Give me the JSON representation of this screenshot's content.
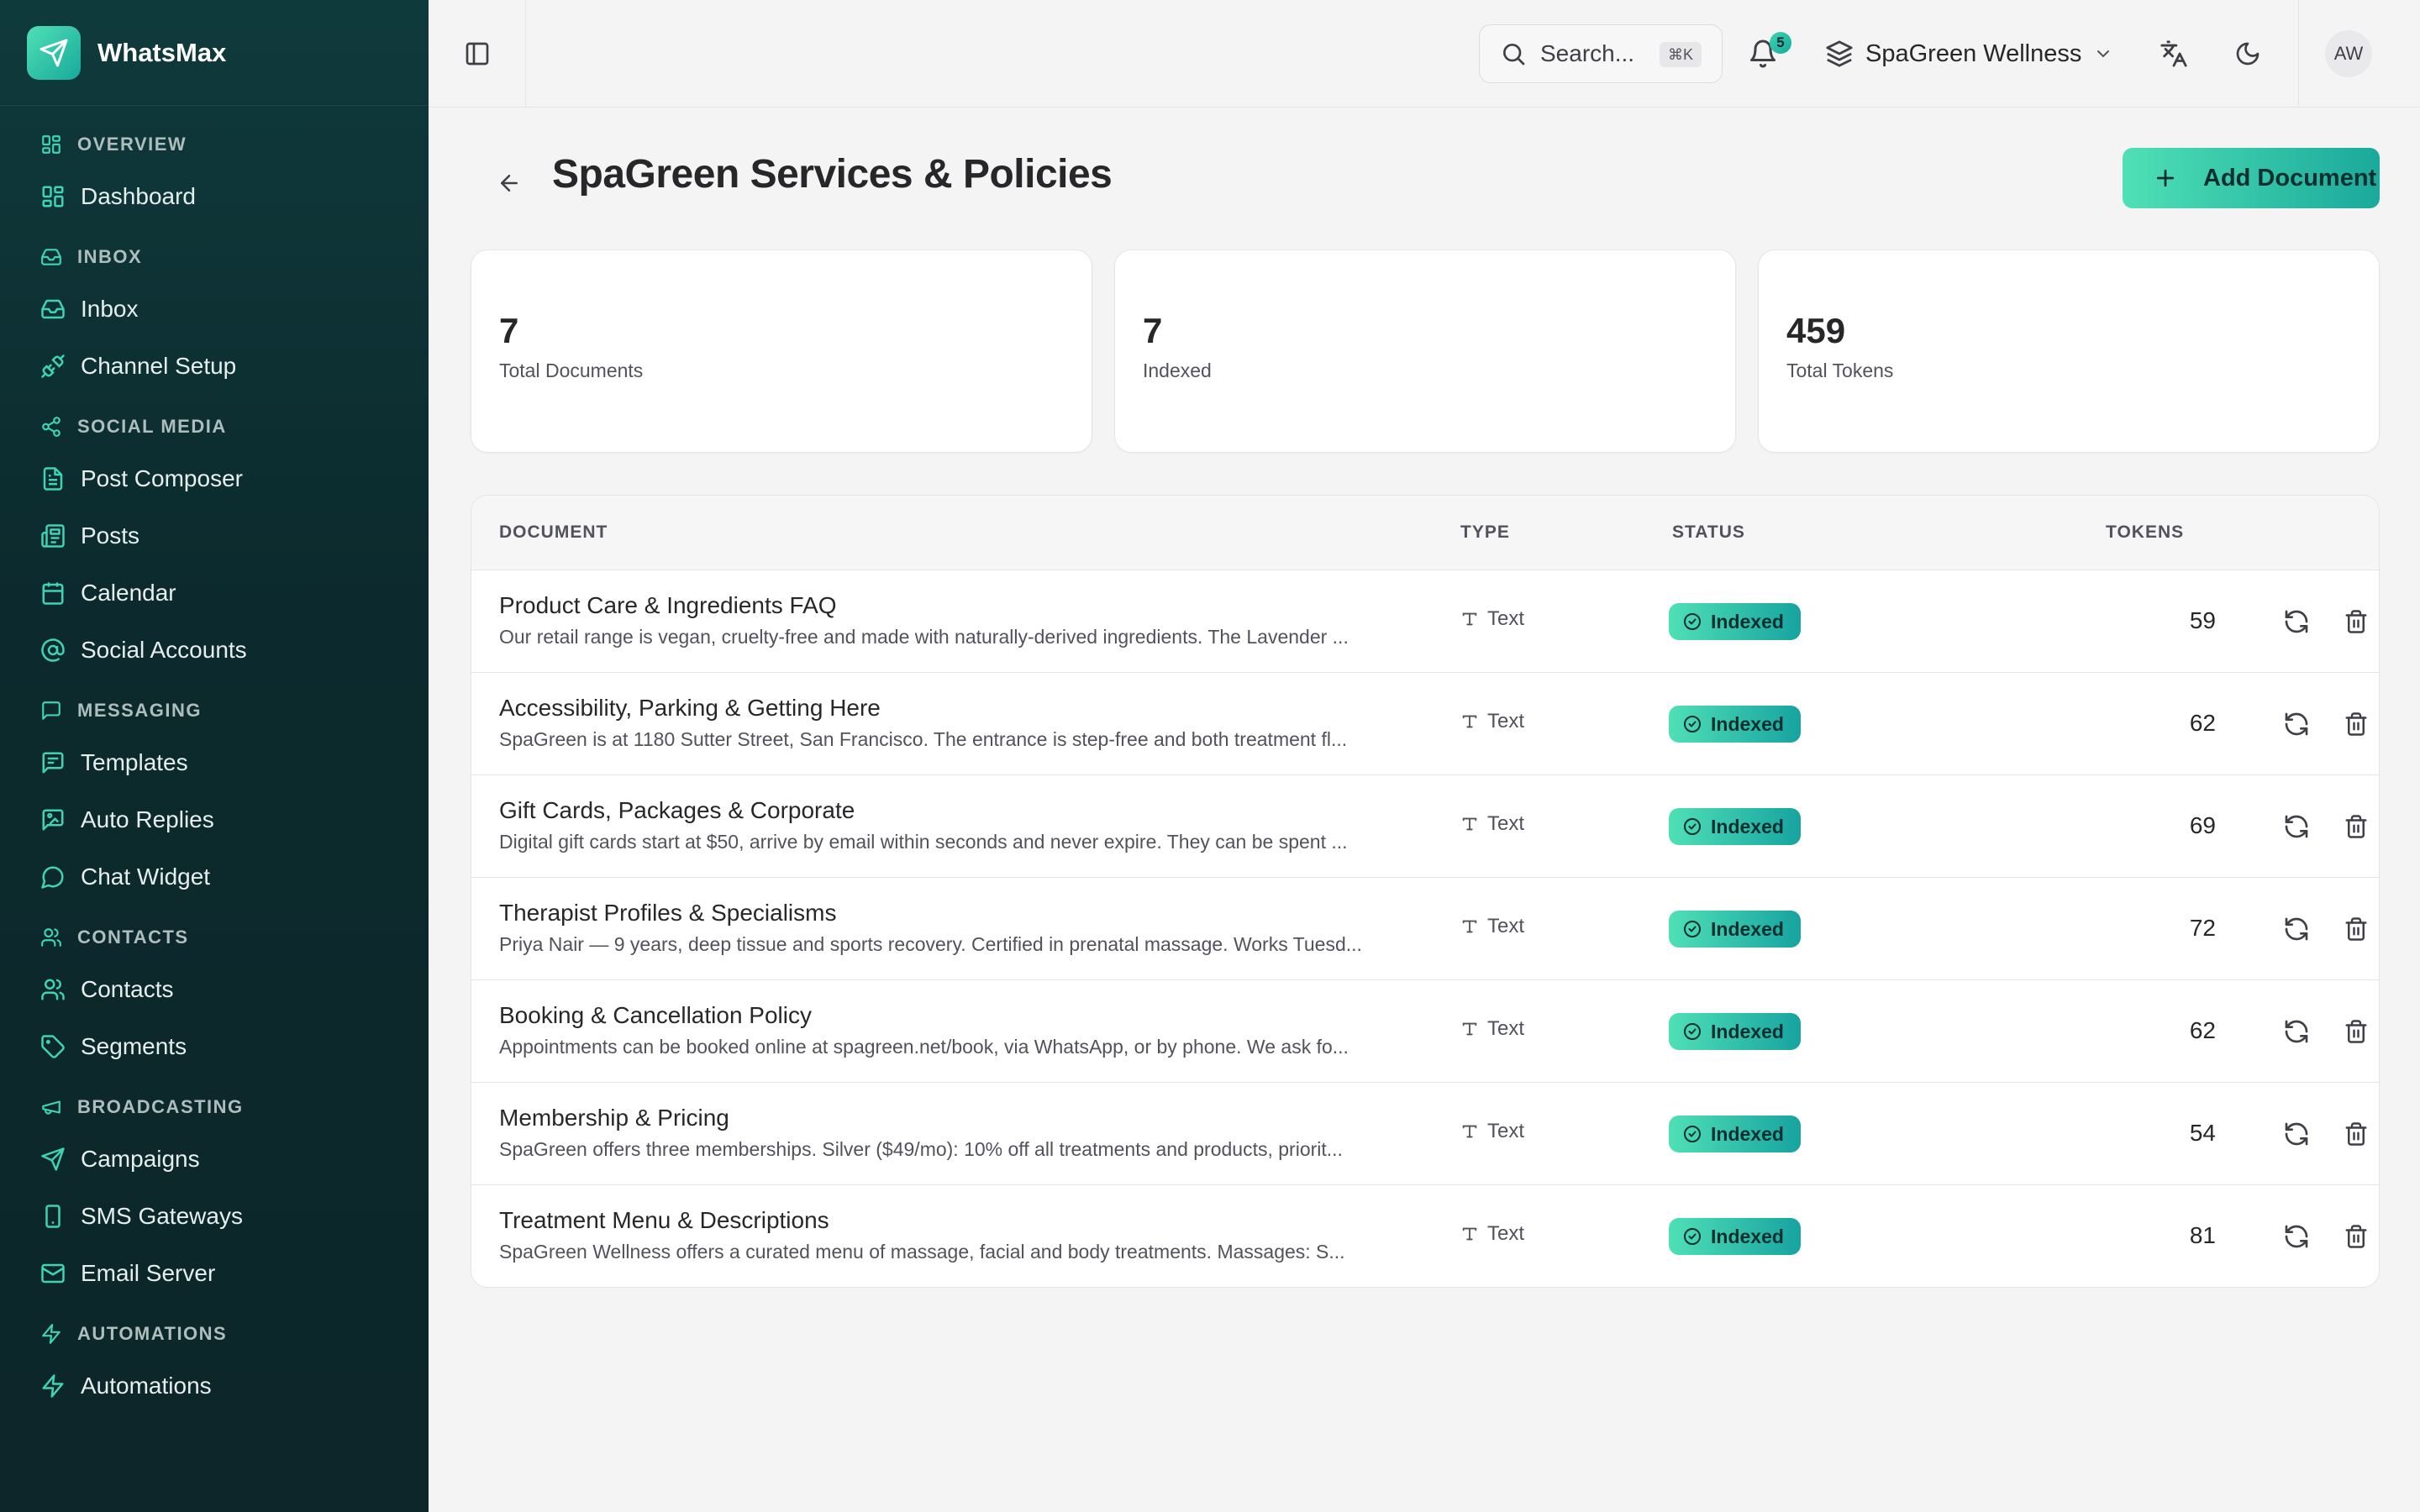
{
  "app": {
    "name": "WhatsMax",
    "accent": "#3fd3b4",
    "sidebar_bg": "#0c2a2d"
  },
  "sidebar": {
    "sections": [
      {
        "label": "OVERVIEW",
        "icon": "grid-icon",
        "items": [
          {
            "label": "Dashboard",
            "icon": "dashboard-icon"
          }
        ]
      },
      {
        "label": "INBOX",
        "icon": "inbox-icon",
        "items": [
          {
            "label": "Inbox",
            "icon": "inbox-icon"
          },
          {
            "label": "Channel Setup",
            "icon": "plug-icon"
          }
        ]
      },
      {
        "label": "SOCIAL MEDIA",
        "icon": "share-icon",
        "items": [
          {
            "label": "Post Composer",
            "icon": "file-text-icon"
          },
          {
            "label": "Posts",
            "icon": "newspaper-icon"
          },
          {
            "label": "Calendar",
            "icon": "calendar-icon"
          },
          {
            "label": "Social Accounts",
            "icon": "at-sign-icon"
          }
        ]
      },
      {
        "label": "MESSAGING",
        "icon": "message-square-icon",
        "items": [
          {
            "label": "Templates",
            "icon": "template-icon"
          },
          {
            "label": "Auto Replies",
            "icon": "message-image-icon"
          },
          {
            "label": "Chat Widget",
            "icon": "message-circle-icon"
          }
        ]
      },
      {
        "label": "CONTACTS",
        "icon": "users-icon",
        "items": [
          {
            "label": "Contacts",
            "icon": "users-icon"
          },
          {
            "label": "Segments",
            "icon": "tag-icon"
          }
        ]
      },
      {
        "label": "BROADCASTING",
        "icon": "megaphone-icon",
        "items": [
          {
            "label": "Campaigns",
            "icon": "send-icon"
          },
          {
            "label": "SMS Gateways",
            "icon": "smartphone-icon"
          },
          {
            "label": "Email Server",
            "icon": "mail-icon"
          }
        ]
      },
      {
        "label": "AUTOMATIONS",
        "icon": "zap-icon",
        "items": [
          {
            "label": "Automations",
            "icon": "zap-icon"
          }
        ]
      }
    ]
  },
  "topbar": {
    "search_placeholder": "Search...",
    "search_shortcut": "⌘K",
    "notification_count": "5",
    "workspace": "SpaGreen Wellness",
    "avatar_initials": "AW"
  },
  "page": {
    "title": "SpaGreen Services & Policies",
    "add_button": "Add Document"
  },
  "stats": [
    {
      "value": "7",
      "label": "Total Documents"
    },
    {
      "value": "7",
      "label": "Indexed"
    },
    {
      "value": "459",
      "label": "Total Tokens"
    }
  ],
  "table": {
    "headers": {
      "document": "DOCUMENT",
      "type": "TYPE",
      "status": "STATUS",
      "tokens": "TOKENS"
    },
    "rows": [
      {
        "title": "Product Care & Ingredients FAQ",
        "description": "Our retail range is vegan, cruelty-free and made with naturally-derived ingredients. The Lavender ...",
        "type": "Text",
        "status": "Indexed",
        "tokens": "59"
      },
      {
        "title": "Accessibility, Parking & Getting Here",
        "description": "SpaGreen is at 1180 Sutter Street, San Francisco. The entrance is step-free and both treatment fl...",
        "type": "Text",
        "status": "Indexed",
        "tokens": "62"
      },
      {
        "title": "Gift Cards, Packages & Corporate",
        "description": "Digital gift cards start at $50, arrive by email within seconds and never expire. They can be spent ...",
        "type": "Text",
        "status": "Indexed",
        "tokens": "69"
      },
      {
        "title": "Therapist Profiles & Specialisms",
        "description": "Priya Nair — 9 years, deep tissue and sports recovery. Certified in prenatal massage. Works Tuesd...",
        "type": "Text",
        "status": "Indexed",
        "tokens": "72"
      },
      {
        "title": "Booking & Cancellation Policy",
        "description": "Appointments can be booked online at spagreen.net/book, via WhatsApp, or by phone. We ask fo...",
        "type": "Text",
        "status": "Indexed",
        "tokens": "62"
      },
      {
        "title": "Membership & Pricing",
        "description": "SpaGreen offers three memberships. Silver ($49/mo): 10% off all treatments and products, priorit...",
        "type": "Text",
        "status": "Indexed",
        "tokens": "54"
      },
      {
        "title": "Treatment Menu & Descriptions",
        "description": "SpaGreen Wellness offers a curated menu of massage, facial and body treatments. Massages: S...",
        "type": "Text",
        "status": "Indexed",
        "tokens": "81"
      }
    ]
  }
}
